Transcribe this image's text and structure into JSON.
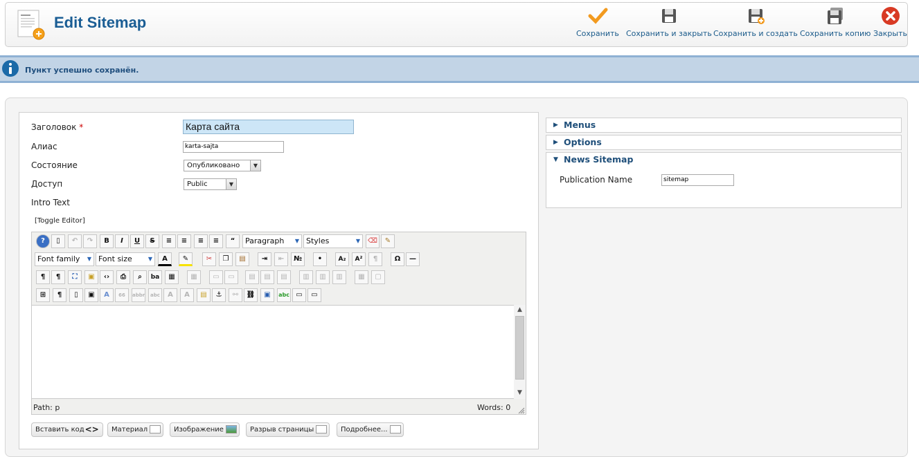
{
  "header": {
    "title": "Edit Sitemap",
    "buttons": {
      "save": "Сохранить",
      "save_close": "Сохранить и закрыть",
      "save_new": "Сохранить и создать",
      "save_copy": "Сохранить копию",
      "close": "Закрыть"
    }
  },
  "message": {
    "text": "Пункт успешно сохранён."
  },
  "form": {
    "title_label": "Заголовок",
    "title_required": "*",
    "title_value": "Карта сайта",
    "alias_label": "Алиас",
    "alias_value": "karta-sajta",
    "state_label": "Состояние",
    "state_value": "Опубликовано",
    "access_label": "Доступ",
    "access_value": "Public",
    "intro_label": "Intro Text",
    "toggle_editor": "[Toggle Editor]"
  },
  "editor": {
    "format_value": "Paragraph",
    "styles_value": "Styles",
    "font_family": "Font family",
    "font_size": "Font size",
    "path_label": "Path:",
    "path_value": "p",
    "words_label": "Words:",
    "words_value": "0"
  },
  "extra_buttons": {
    "insert_code": "Вставить код",
    "article": "Материал",
    "image": "Изображение",
    "pagebreak": "Разрыв страницы",
    "readmore": "Подробнее..."
  },
  "panels": {
    "menus": "Menus",
    "options": "Options",
    "news_sitemap": "News Sitemap",
    "publication_name_label": "Publication Name",
    "publication_name_value": "sitemap"
  },
  "colors": {
    "accent": "#1a5d94",
    "message_bg": "#c2d4e6",
    "save_check": "#f29a1f",
    "close_red": "#d83a24"
  }
}
